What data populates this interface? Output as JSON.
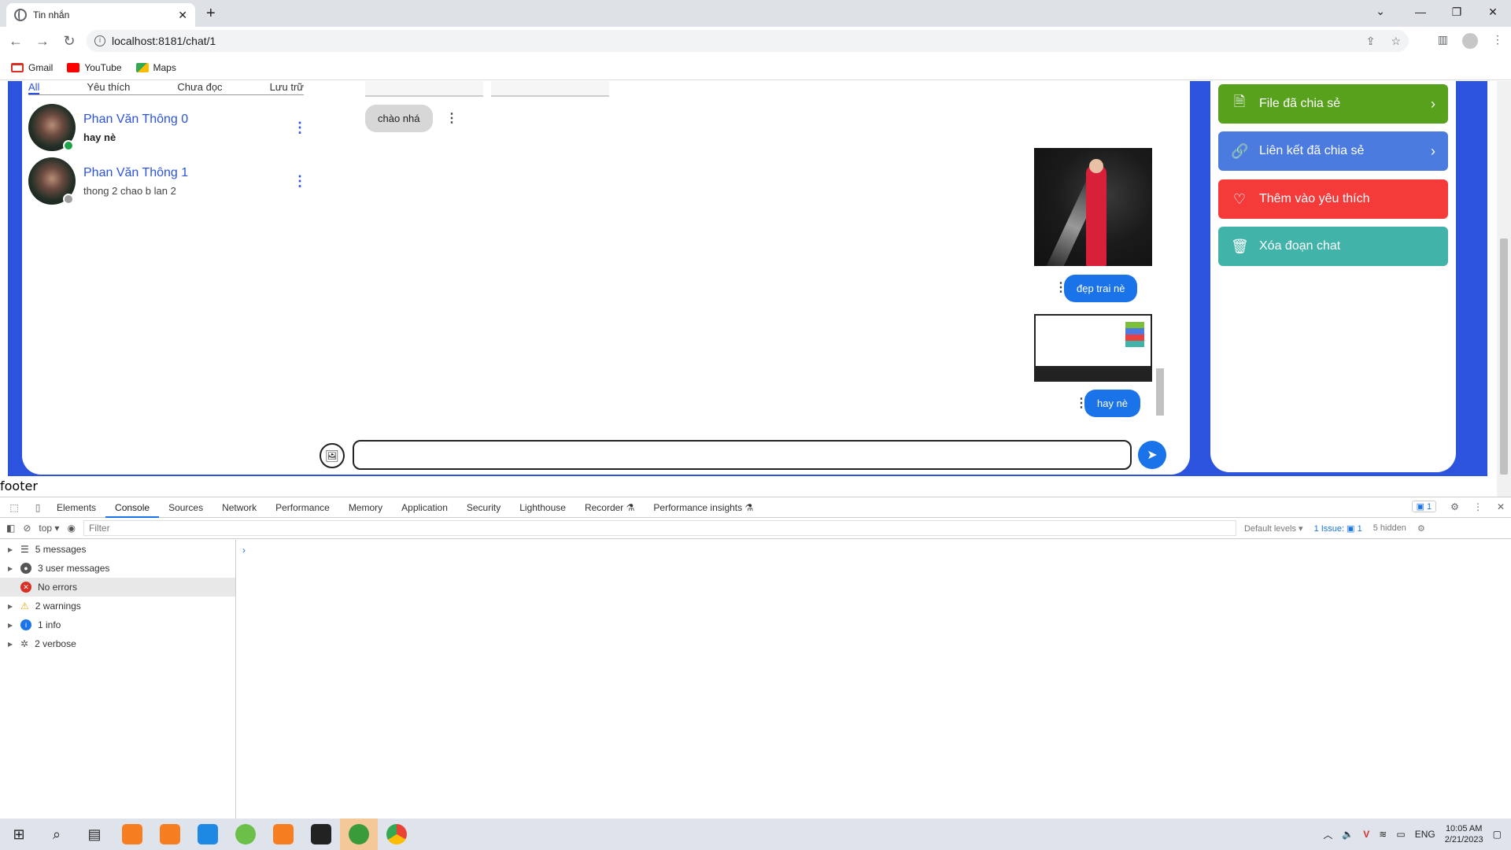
{
  "browser": {
    "tab_title": "Tin nhắn",
    "url": "localhost:8181/chat/1",
    "bookmarks": [
      "Gmail",
      "YouTube",
      "Maps"
    ]
  },
  "chat": {
    "filters": [
      "All",
      "Yêu thích",
      "Chưa đọc",
      "Lưu trữ"
    ],
    "contacts": [
      {
        "name": "Phan Văn Thông 0",
        "last": "hay nè",
        "status_color": "#1fa34a"
      },
      {
        "name": "Phan Văn Thông 1",
        "last": "thong 2 chao b lan 2",
        "status_color": "#9e9e9e"
      }
    ],
    "messages": {
      "in1": "chào nhá",
      "out1": "đẹp trai nè",
      "out2": "hay nè"
    },
    "input_placeholder": ""
  },
  "panel": {
    "actions": [
      {
        "label": "File đã chia sẻ",
        "color": "#57a11c",
        "icon": "file-icon"
      },
      {
        "label": "Liên kết đã chia sẻ",
        "color": "#4c7be0",
        "icon": "link-icon"
      },
      {
        "label": "Thêm vào yêu thích",
        "color": "#f53a3a",
        "icon": "heart-icon"
      },
      {
        "label": "Xóa đoạn chat",
        "color": "#42b3a8",
        "icon": "trash-icon"
      }
    ]
  },
  "footer_text": "footer",
  "devtools": {
    "tabs": [
      "Elements",
      "Console",
      "Sources",
      "Network",
      "Performance",
      "Memory",
      "Application",
      "Security",
      "Lighthouse",
      "Recorder ⚗",
      "Performance insights ⚗"
    ],
    "issues_badge": "1",
    "context": "top ▾",
    "filter_placeholder": "Filter",
    "levels": "Default levels ▾",
    "issue_count": "1 Issue: ▣ 1",
    "hidden": "5 hidden",
    "sidebar": [
      {
        "label": "5 messages",
        "icon_color": "#555"
      },
      {
        "label": "3 user messages",
        "icon_color": "#555"
      },
      {
        "label": "No errors",
        "icon_color": "#d93025"
      },
      {
        "label": "2 warnings",
        "icon_color": "#f2a600"
      },
      {
        "label": "1 info",
        "icon_color": "#1a73e8"
      },
      {
        "label": "2 verbose",
        "icon_color": "#555"
      }
    ]
  },
  "taskbar": {
    "lang": "ENG",
    "time": "10:05 AM",
    "date": "2/21/2023"
  }
}
